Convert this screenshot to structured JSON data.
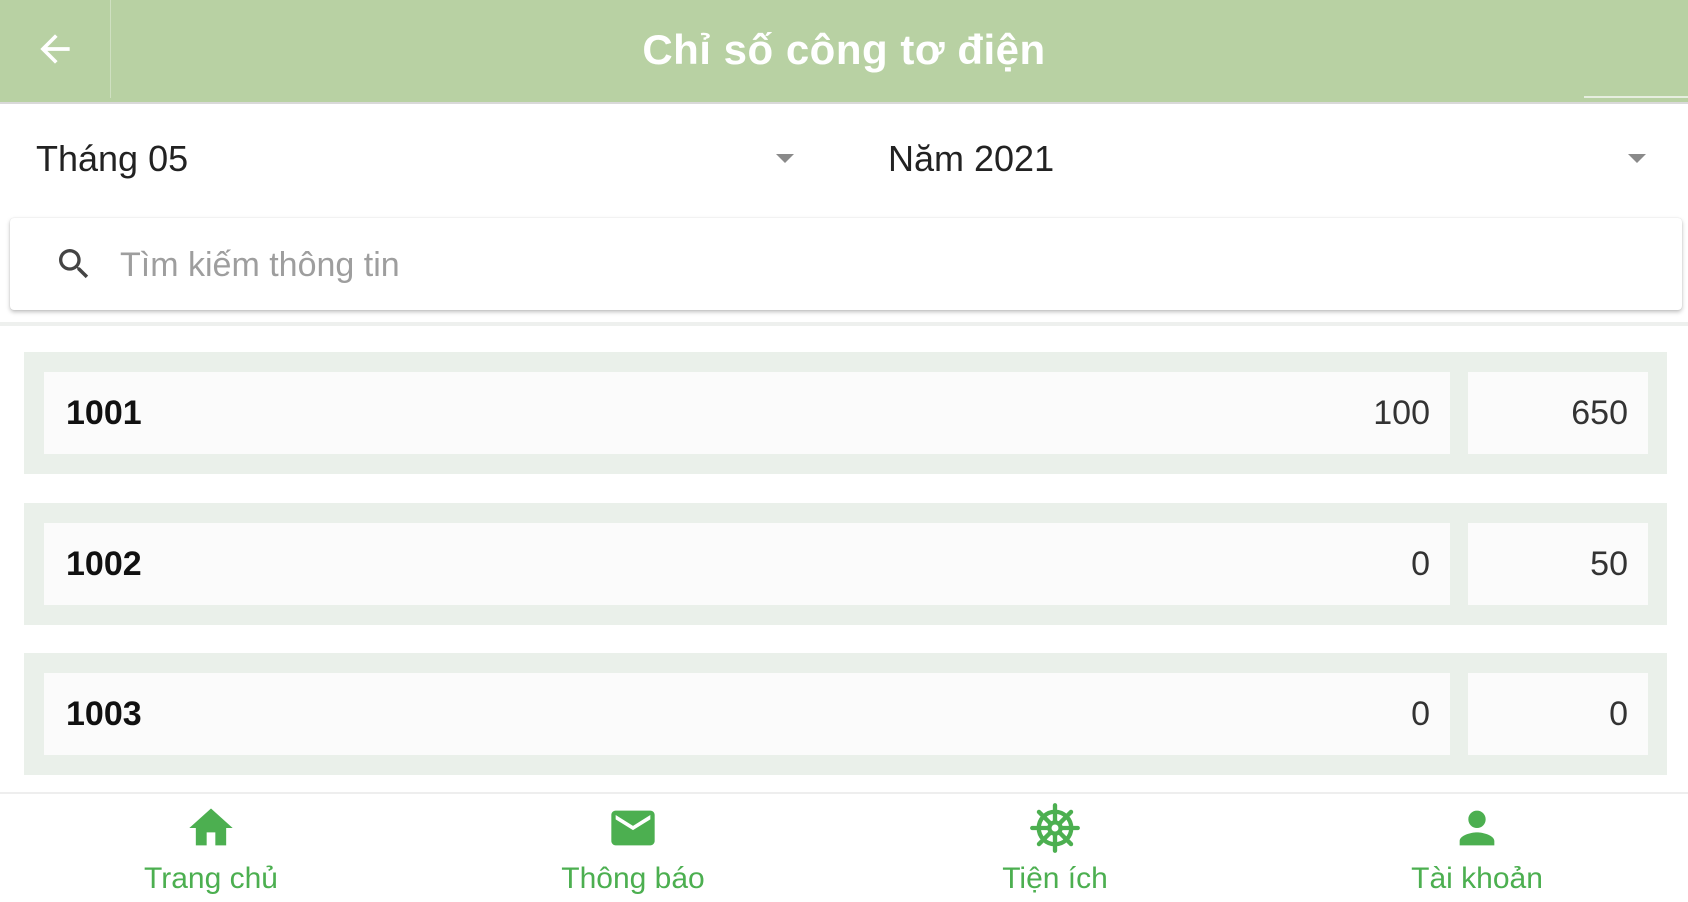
{
  "header": {
    "title": "Chỉ số công tơ điện",
    "back_icon": "arrow-left-icon"
  },
  "filters": {
    "month": "Tháng 05",
    "year": "Năm 2021"
  },
  "search": {
    "placeholder": "Tìm kiếm thông tin",
    "value": ""
  },
  "rows": [
    {
      "name": "1001",
      "v1": "100",
      "v2": "650"
    },
    {
      "name": "1002",
      "v1": "0",
      "v2": "50"
    },
    {
      "name": "1003",
      "v1": "0",
      "v2": "0"
    }
  ],
  "nav": [
    {
      "label": "Trang chủ",
      "icon": "home-icon"
    },
    {
      "label": "Thông báo",
      "icon": "mail-icon"
    },
    {
      "label": "Tiện ích",
      "icon": "settings-wheel-icon"
    },
    {
      "label": "Tài khoản",
      "icon": "account-icon"
    }
  ],
  "colors": {
    "header_bg": "#b8d1a3",
    "accent": "#4caf50",
    "row_bg": "#eaf0ea"
  }
}
